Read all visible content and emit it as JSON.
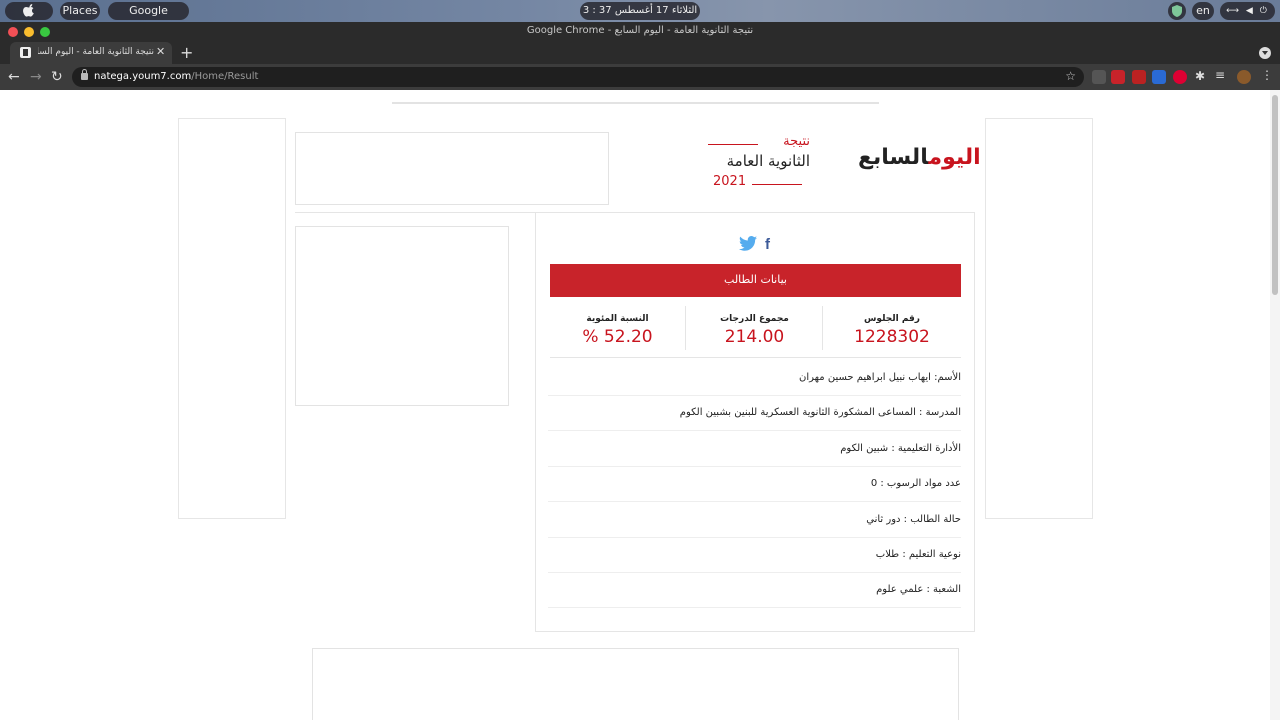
{
  "system_bar": {
    "places": "Places",
    "app": "Google Chrome",
    "clock": "الثلاثاء 17 أغسطس 37 : 3 م",
    "lang": "en"
  },
  "window": {
    "title": "Google Chrome - نتيجة الثانوية العامة - اليوم السابع"
  },
  "tab": {
    "title": "نتيجة الثانوية العامة - اليوم السابع",
    "close": "✕",
    "new": "+"
  },
  "toolbar": {
    "url_host": "natega.youm7.com",
    "url_path": "/Home/Result"
  },
  "header": {
    "logo_red": "اليوم",
    "logo_dark": "السابع",
    "title_line1": "نتيجة",
    "title_line2": "الثانوية العامة",
    "title_year": "2021"
  },
  "card": {
    "section_title": "بيانات الطالب",
    "stats": [
      {
        "label": "رقم الجلوس",
        "value": "1228302"
      },
      {
        "label": "مجموع الدرجات",
        "value": "214.00"
      },
      {
        "label": "النسبة المئوية",
        "value": "% 52.20"
      }
    ],
    "rows": [
      "الأسم: ايهاب نبيل ابراهيم حسين مهران",
      "المدرسة : المساعى المشكورة الثانوية العسكرية للبنين بشبين الكوم",
      "الأدارة التعليمية : شبين الكوم",
      "عدد مواد الرسوب : 0",
      "حالة الطالب : دور ثاني",
      "نوعية التعليم : طلاب",
      "الشعبة : علمي علوم"
    ]
  },
  "colors": {
    "accent": "#c8232a",
    "facebook": "#3b5998",
    "twitter": "#55acee"
  }
}
